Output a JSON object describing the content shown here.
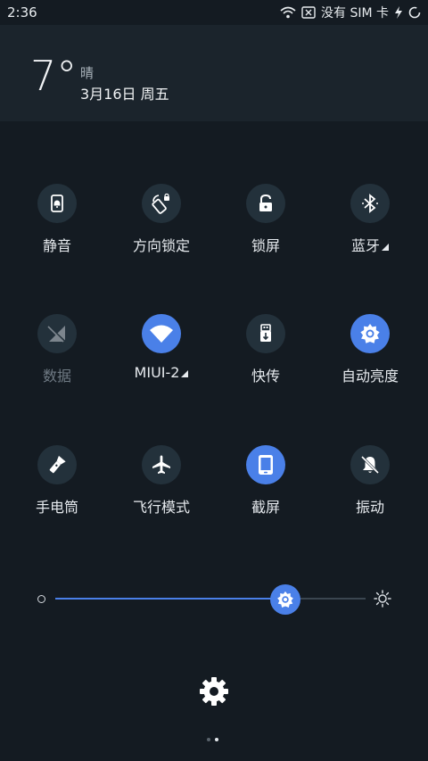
{
  "status_bar": {
    "time": "2:36",
    "sim_text": "没有 SIM 卡"
  },
  "header": {
    "temperature": "7°",
    "weather": "晴",
    "date": "3月16日 周五"
  },
  "tiles": [
    {
      "label": "静音",
      "icon": "silent-icon",
      "active": false
    },
    {
      "label": "方向锁定",
      "icon": "rotation-lock-icon",
      "active": false
    },
    {
      "label": "锁屏",
      "icon": "lock-icon",
      "active": false
    },
    {
      "label": "蓝牙",
      "icon": "bluetooth-icon",
      "active": false
    },
    {
      "label": "数据",
      "icon": "mobile-data-icon",
      "active": false
    },
    {
      "label": "MIUI-2",
      "icon": "wifi-icon",
      "active": true
    },
    {
      "label": "快传",
      "icon": "usb-transfer-icon",
      "active": false
    },
    {
      "label": "自动亮度",
      "icon": "auto-brightness-icon",
      "active": true
    },
    {
      "label": "手电筒",
      "icon": "flashlight-icon",
      "active": false
    },
    {
      "label": "飞行模式",
      "icon": "airplane-icon",
      "active": false
    },
    {
      "label": "截屏",
      "icon": "screenshot-icon",
      "active": true
    },
    {
      "label": "振动",
      "icon": "vibrate-off-icon",
      "active": false
    }
  ],
  "brightness": {
    "level": 0.74
  },
  "colors": {
    "accent": "#4a80e8",
    "background": "#141b22",
    "tile": "#23313b"
  },
  "pager": {
    "pages": 2,
    "current": 2
  }
}
